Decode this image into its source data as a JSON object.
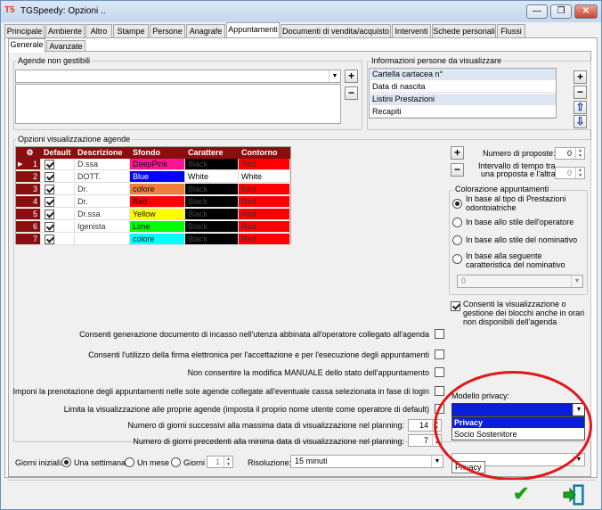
{
  "window": {
    "logo": "T5",
    "title": "TGSpeedy: Opzioni ..",
    "buttons": [
      "—",
      "❐",
      "✕"
    ]
  },
  "tabs": [
    "Principale",
    "Ambiente",
    "Altro",
    "Stampe",
    "Persone",
    "Anagrafe",
    "Appuntamenti",
    "Documenti di vendita/acquisto",
    "Interventi",
    "Schede personali",
    "Flussi"
  ],
  "active_tab": "Appuntamenti",
  "subtabs": [
    "Generale",
    "Avanzate"
  ],
  "agende_non_gestibili": {
    "label": "Agende non gestibili"
  },
  "info_persone": {
    "label": "Informazioni persone da visualizzare",
    "items": [
      "Cartella cartacea n°",
      "Data di nascita",
      "Listini Prestazioni",
      "Recapiti"
    ]
  },
  "opzioni": {
    "label": "Opzioni visualizzazione agende"
  },
  "grid": {
    "columns": [
      "",
      "Default",
      "Descrizione",
      "Sfondo",
      "Carattere",
      "Contorno"
    ],
    "rows": [
      {
        "n": "1",
        "desc": "D.ssa",
        "sfondo": "DeepPink",
        "sfondo_color": "#ff1493",
        "car": "Black",
        "car_color": "#000000",
        "cont": "Red",
        "cont_color": "#ff0000"
      },
      {
        "n": "2",
        "desc": "DOTT.",
        "sfondo": "Blue",
        "sfondo_color": "#0000ff",
        "car": "White",
        "car_color": "#ffffff",
        "cont": "White",
        "cont_color": "#ffffff"
      },
      {
        "n": "3",
        "desc": "Dr.",
        "sfondo": "colore",
        "sfondo_color": "#f07d3a",
        "car": "Black",
        "car_color": "#000000",
        "cont": "Red",
        "cont_color": "#ff0000"
      },
      {
        "n": "4",
        "desc": "Dr.",
        "sfondo": "Red",
        "sfondo_color": "#ff0000",
        "car": "Black",
        "car_color": "#000000",
        "cont": "Red",
        "cont_color": "#ff0000"
      },
      {
        "n": "5",
        "desc": "Dr.ssa",
        "sfondo": "Yellow",
        "sfondo_color": "#ffff00",
        "car": "Black",
        "car_color": "#000000",
        "cont": "Red",
        "cont_color": "#ff0000"
      },
      {
        "n": "6",
        "desc": "Igenista",
        "sfondo": "Lime",
        "sfondo_color": "#00ff00",
        "car": "Black",
        "car_color": "#000000",
        "cont": "Red",
        "cont_color": "#ff0000"
      },
      {
        "n": "7",
        "desc": "",
        "sfondo": "colore",
        "sfondo_color": "#00ffff",
        "car": "Black",
        "car_color": "#000000",
        "cont": "Red",
        "cont_color": "#ff0000"
      }
    ]
  },
  "proposte": {
    "numero_label": "Numero di proposte:",
    "numero_value": "0",
    "intervallo_label_1": "Intervallo di tempo tra",
    "intervallo_label_2": "una proposta e l'altra:",
    "intervallo_value": "0"
  },
  "colorazione": {
    "label": "Colorazione appuntamenti",
    "options": [
      "In base al tipo di Prestazioni odontoiatriche",
      "In base allo stile dell'operatore",
      "In base allo stile del nominativo",
      "In base alla seguente caratteristica del nominativo"
    ],
    "combo_value": "0"
  },
  "consenti_blocchi": "Consenti la visualizzazione o gestione dei blocchi anche in orari non disponibili dell'agenda",
  "checks": [
    "Consenti generazione documento di incasso nell'utenza abbinata all'operatore collegato all'agenda",
    "Consenti l'utilizzo della firma elettronica per l'accettazione e per l'esecuzione degli appuntamenti",
    "Non consentire la modifica MANUALE dello stato dell'appuntamento",
    "Imponi la prenotazione degli appuntamenti nelle sole agende collegate all'eventuale cassa selezionata in fase di login",
    "Limita la visualizzazione alle proprie agende (imposta il proprio nome utente come operatore di default)"
  ],
  "giorni_succ": {
    "label": "Numero di giorni successivi alla massima data di visualizzazione nel planning:",
    "value": "14"
  },
  "giorni_prec": {
    "label": "Numero di giorni precedenti alla minima data di visualizzazione nel planning:",
    "value": "7"
  },
  "giorni_iniziali": {
    "label": "Giorni iniziali:",
    "options": [
      "Una settimana",
      "Un mese",
      "Giorni"
    ],
    "giorni_value": "1"
  },
  "risoluzione": {
    "label": "Risoluzione:",
    "value": "15 minuti"
  },
  "modello_privacy": {
    "label": "Modello privacy:",
    "options": [
      "Privacy",
      "Socio Sostenitore"
    ],
    "tooltip": "Privacy"
  },
  "accent": "#0a1ed9"
}
